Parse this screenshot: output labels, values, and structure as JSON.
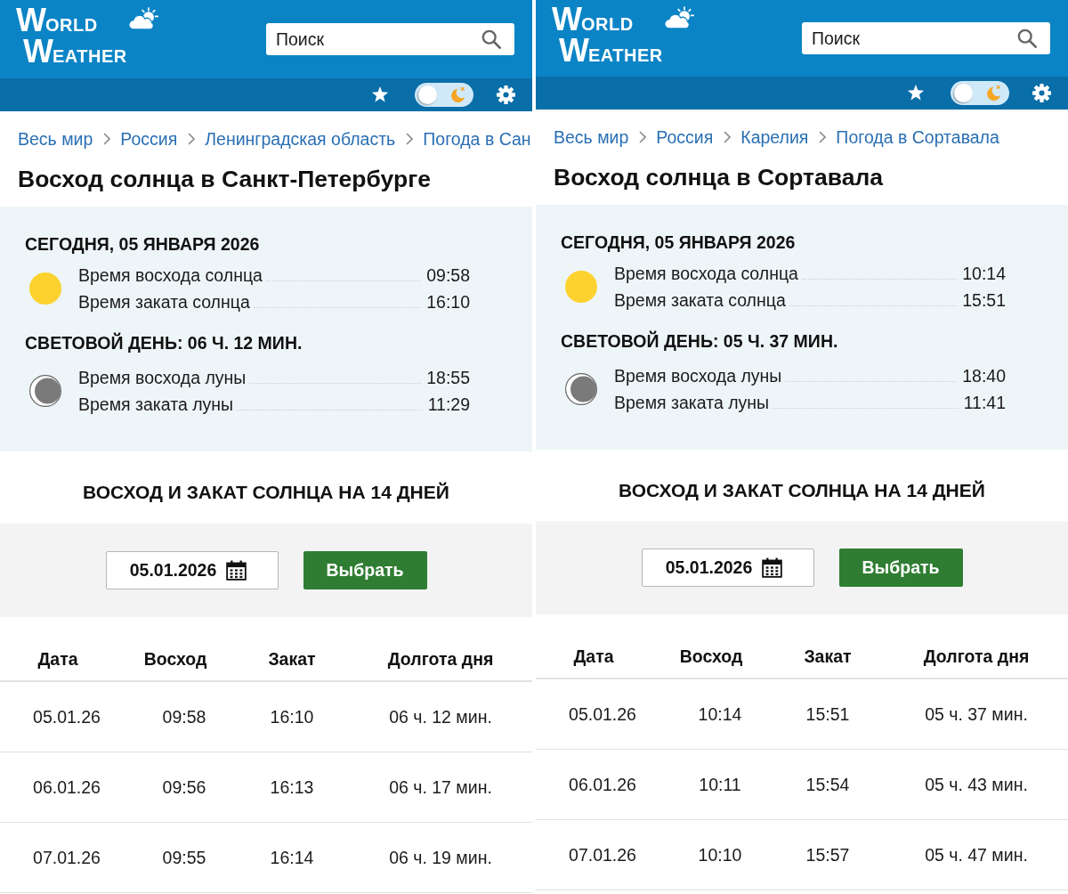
{
  "panels": [
    {
      "header": {
        "logo": [
          "WORLD",
          "WEATHER"
        ],
        "search": {
          "placeholder": "Поиск"
        }
      },
      "toolbar": {
        "theme_toggle": {
          "on": false
        }
      },
      "breadcrumbs": [
        "Весь мир",
        "Россия",
        "Ленинградская область",
        "Погода в Сан"
      ],
      "title": "Восход солнца в Санкт-Петербурге",
      "today": {
        "heading": "СЕГОДНЯ, 05 ЯНВАРЯ 2026",
        "sun": [
          {
            "label": "Время восхода солнца",
            "time": "09:58"
          },
          {
            "label": "Время заката солнца",
            "time": "16:10"
          }
        ],
        "daylight": "СВЕТОВОЙ ДЕНЬ: 06 Ч. 12 МИН.",
        "moon": [
          {
            "label": "Время восхода луны",
            "time": "18:55"
          },
          {
            "label": "Время заката луны",
            "time": "11:29"
          }
        ]
      },
      "forecast": {
        "heading": "ВОСХОД И ЗАКАТ СОЛНЦА НА 14 ДНЕЙ",
        "date_field": {
          "value": "05.01.2026"
        },
        "button": "Выбрать",
        "table": {
          "columns": [
            "Дата",
            "Восход",
            "Закат",
            "Долгота дня"
          ],
          "rows": [
            [
              "05.01.26",
              "09:58",
              "16:10",
              "06 ч. 12 мин."
            ],
            [
              "06.01.26",
              "09:56",
              "16:13",
              "06 ч. 17 мин."
            ],
            [
              "07.01.26",
              "09:55",
              "16:14",
              "06 ч. 19 мин."
            ]
          ]
        }
      }
    },
    {
      "header": {
        "logo": [
          "WORLD",
          "WEATHER"
        ],
        "search": {
          "placeholder": "Поиск"
        }
      },
      "toolbar": {
        "theme_toggle": {
          "on": false
        }
      },
      "breadcrumbs": [
        "Весь мир",
        "Россия",
        "Карелия",
        "Погода в Сортавала"
      ],
      "title": "Восход солнца в Сортавала",
      "today": {
        "heading": "СЕГОДНЯ, 05 ЯНВАРЯ 2026",
        "sun": [
          {
            "label": "Время восхода солнца",
            "time": "10:14"
          },
          {
            "label": "Время заката солнца",
            "time": "15:51"
          }
        ],
        "daylight": "СВЕТОВОЙ ДЕНЬ: 05 Ч. 37 МИН.",
        "moon": [
          {
            "label": "Время восхода луны",
            "time": "18:40"
          },
          {
            "label": "Время заката луны",
            "time": "11:41"
          }
        ]
      },
      "forecast": {
        "heading": "ВОСХОД И ЗАКАТ СОЛНЦА НА 14 ДНЕЙ",
        "date_field": {
          "value": "05.01.2026"
        },
        "button": "Выбрать",
        "table": {
          "columns": [
            "Дата",
            "Восход",
            "Закат",
            "Долгота дня"
          ],
          "rows": [
            [
              "05.01.26",
              "10:14",
              "15:51",
              "05 ч. 37 мин."
            ],
            [
              "06.01.26",
              "10:11",
              "15:54",
              "05 ч. 43 мин."
            ],
            [
              "07.01.26",
              "10:10",
              "15:57",
              "05 ч. 47 мин."
            ]
          ]
        }
      }
    }
  ]
}
